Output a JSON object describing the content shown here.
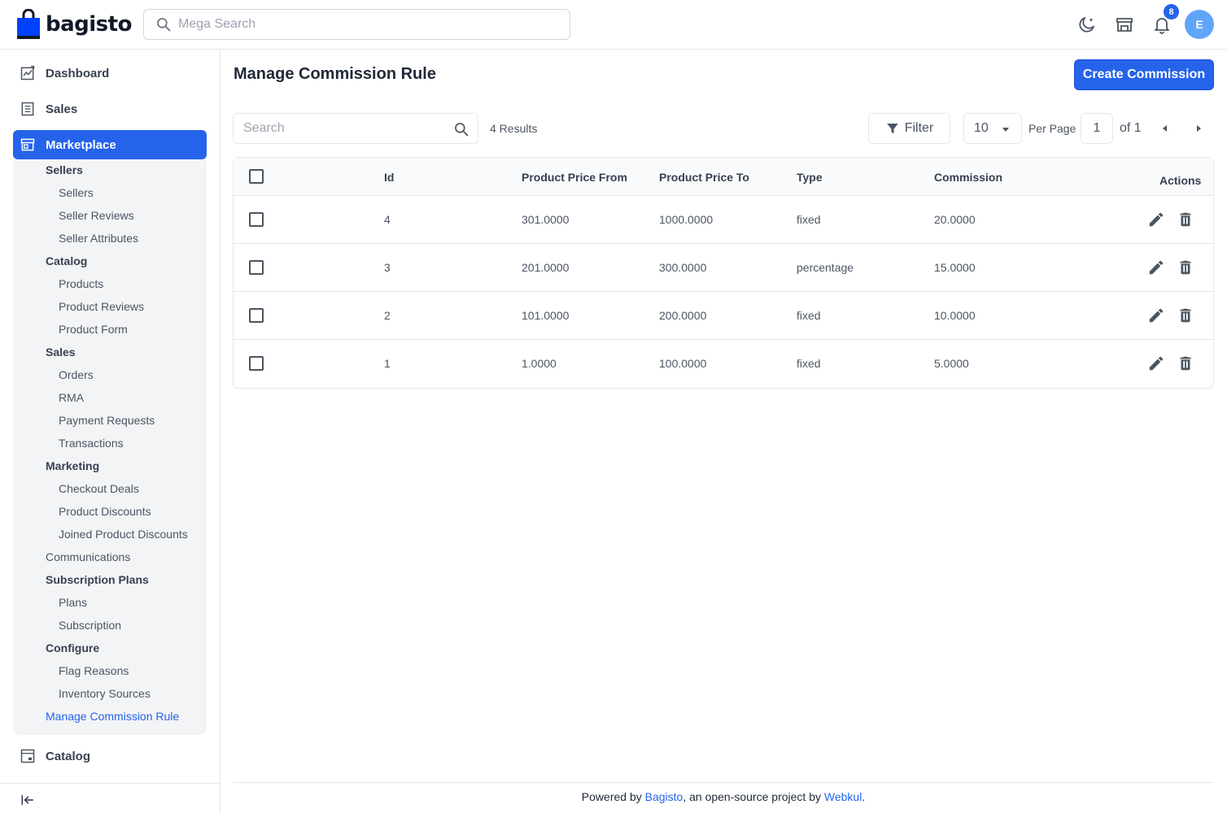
{
  "header": {
    "logo_text": "bagisto",
    "search_placeholder": "Mega Search",
    "notification_count": "8",
    "avatar_initial": "E"
  },
  "sidebar": {
    "dashboard": "Dashboard",
    "sales": "Sales",
    "marketplace": "Marketplace",
    "catalog": "Catalog",
    "marketplace_menu": {
      "sellers_group": "Sellers",
      "sellers": "Sellers",
      "seller_reviews": "Seller Reviews",
      "seller_attributes": "Seller Attributes",
      "catalog_group": "Catalog",
      "products": "Products",
      "product_reviews": "Product Reviews",
      "product_form": "Product Form",
      "sales_group": "Sales",
      "orders": "Orders",
      "rma": "RMA",
      "payment_requests": "Payment Requests",
      "transactions": "Transactions",
      "marketing_group": "Marketing",
      "checkout_deals": "Checkout Deals",
      "product_discounts": "Product Discounts",
      "joined_product_discounts": "Joined Product Discounts",
      "communications": "Communications",
      "subscription_group": "Subscription Plans",
      "plans": "Plans",
      "subscription": "Subscription",
      "configure_group": "Configure",
      "flag_reasons": "Flag Reasons",
      "inventory_sources": "Inventory Sources",
      "manage_commission_rule": "Manage Commission Rule"
    }
  },
  "main": {
    "title": "Manage Commission Rule",
    "create_button": "Create Commission",
    "search_placeholder": "Search",
    "results": "4 Results",
    "filter": "Filter",
    "per_page_value": "10",
    "per_page_label": "Per Page",
    "page_number": "1",
    "page_of": "of 1"
  },
  "table": {
    "columns": {
      "id": "Id",
      "price_from": "Product Price From",
      "price_to": "Product Price To",
      "type": "Type",
      "commission": "Commission",
      "actions": "Actions"
    },
    "rows": [
      {
        "id": "4",
        "from": "301.0000",
        "to": "1000.0000",
        "type": "fixed",
        "commission": "20.0000"
      },
      {
        "id": "3",
        "from": "201.0000",
        "to": "300.0000",
        "type": "percentage",
        "commission": "15.0000"
      },
      {
        "id": "2",
        "from": "101.0000",
        "to": "200.0000",
        "type": "fixed",
        "commission": "10.0000"
      },
      {
        "id": "1",
        "from": "1.0000",
        "to": "100.0000",
        "type": "fixed",
        "commission": "5.0000"
      }
    ]
  },
  "footer": {
    "prefix": "Powered by ",
    "bagisto": "Bagisto",
    "middle": ", an open-source project by ",
    "webkul": "Webkul",
    "suffix": "."
  },
  "colors": {
    "accent": "#2563eb",
    "sidebar_panel": "#f3f4f6",
    "avatar": "#60a5fa"
  }
}
